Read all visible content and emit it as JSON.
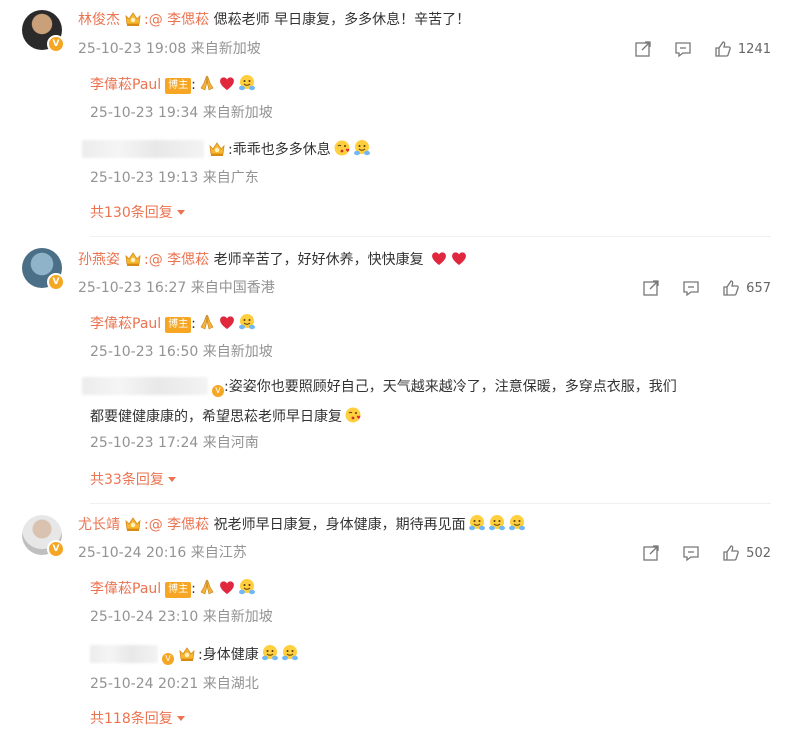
{
  "comments": [
    {
      "author": "林俊杰",
      "mention": ":@ 李偲菘",
      "text": " 偲菘老师 早日康复，多多休息！辛苦了！",
      "meta": "25-10-23 19:08 来自新加坡",
      "likes": "1241",
      "replies": [
        {
          "author": "李偉菘Paul",
          "badge": "博主",
          "meta": "25-10-23 19:34 来自新加坡"
        },
        {
          "text": ":乖乖也多多休息",
          "meta": "25-10-23 19:13 来自广东"
        }
      ],
      "more": "共130条回复"
    },
    {
      "author": "孙燕姿",
      "mention": ":@ 李偲菘",
      "text": " 老师辛苦了，好好休养，快快康复",
      "meta": "25-10-23 16:27 来自中国香港",
      "likes": "657",
      "replies": [
        {
          "author": "李偉菘Paul",
          "badge": "博主",
          "meta": "25-10-23 16:50 来自新加坡"
        },
        {
          "text": ":姿姿你也要照顾好自己，天气越来越冷了，注意保暖，多穿点衣服，我们",
          "text2": "都要健健康康的，希望思菘老师早日康复",
          "meta": "25-10-23 17:24 来自河南"
        }
      ],
      "more": "共33条回复"
    },
    {
      "author": "尤长靖",
      "mention": ":@ 李偲菘",
      "text": " 祝老师早日康复，身体健康，期待再见面",
      "meta": "25-10-24 20:16 来自江苏",
      "likes": "502",
      "replies": [
        {
          "author": "李偉菘Paul",
          "badge": "博主",
          "meta": "25-10-24 23:10 来自新加坡"
        },
        {
          "text": ":身体健康",
          "meta": "25-10-24 20:21 来自湖北"
        }
      ],
      "more": "共118条回复"
    }
  ],
  "icons": {
    "share": "share-icon",
    "comment": "comment-icon",
    "like": "like-icon",
    "crown": "crown-icon",
    "pray": "pray-emoji",
    "heart": "heart-emoji",
    "hug": "hug-emoji",
    "kiss": "kiss-emoji"
  },
  "colors": {
    "accent": "#eb7350",
    "meta": "#939393",
    "badge": "#f6a623"
  }
}
